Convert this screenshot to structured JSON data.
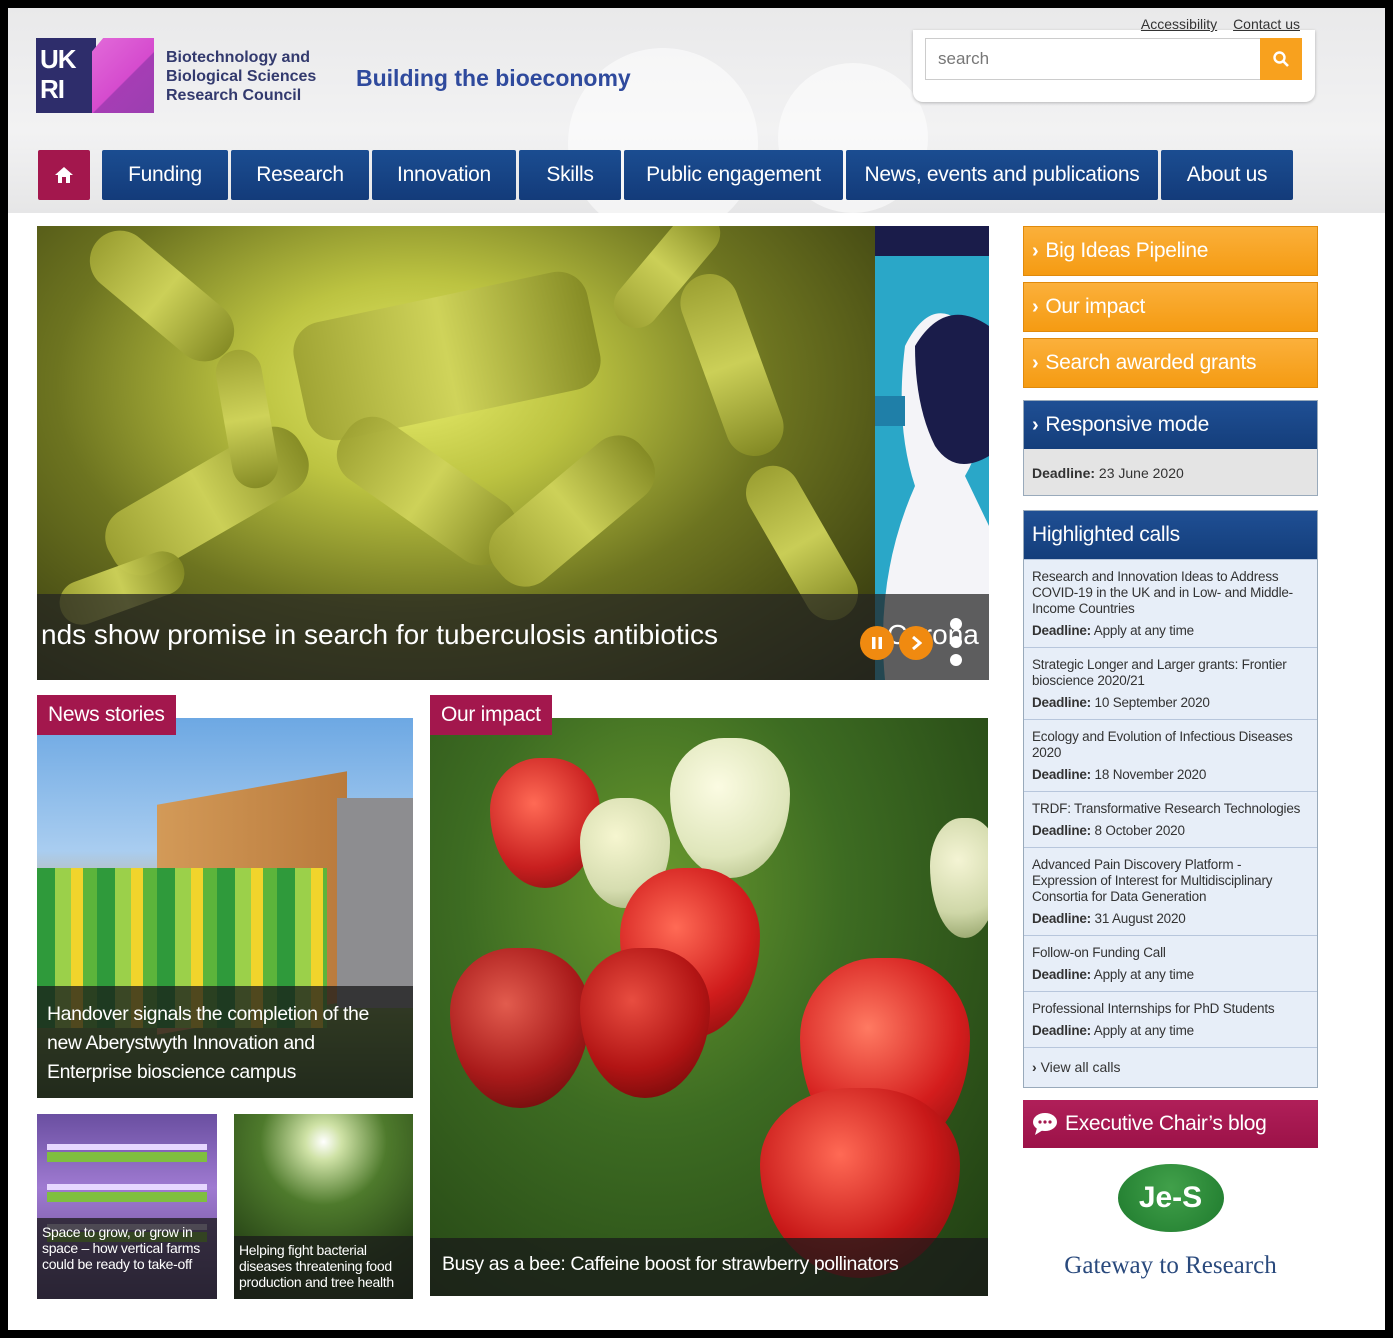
{
  "header": {
    "org_lines": [
      "Biotechnology and",
      "Biological Sciences",
      "Research Council"
    ],
    "logo_text": "UK RI",
    "tagline": "Building the bioeconomy",
    "utility_links": [
      "Accessibility",
      "Contact us"
    ],
    "search_placeholder": "search"
  },
  "nav": {
    "home_icon": "home-icon",
    "items": [
      "Funding",
      "Research",
      "Innovation",
      "Skills",
      "Public engagement",
      "News, events and publications",
      "About us"
    ]
  },
  "hero": {
    "caption": "nds show promise in search for tuberculosis antibiotics",
    "caption_next": "Corona",
    "pause_icon": "pause-icon",
    "next_icon": "chevron-right-icon"
  },
  "news": {
    "tag": "News stories",
    "main_caption": "Handover signals the completion of the new Aberystwyth Innovation and Enterprise bioscience campus",
    "small": [
      "Space to grow, or grow in space – how vertical farms could be ready to take-off",
      "Helping fight bacterial diseases threatening food production and tree health"
    ]
  },
  "impact": {
    "tag": "Our impact",
    "caption": "Busy as a bee: Caffeine boost for strawberry pollinators"
  },
  "sidebar": {
    "orange": [
      "Big Ideas Pipeline",
      "Our impact",
      "Search awarded grants"
    ],
    "responsive": {
      "title": "Responsive mode",
      "deadline_label": "Deadline:",
      "deadline": "23 June 2020"
    },
    "calls_title": "Highlighted calls",
    "calls": [
      {
        "title": "Research and Innovation Ideas to Address COVID-19 in the UK and in Low- and Middle-Income Countries",
        "deadline": "Apply at any time"
      },
      {
        "title": "Strategic Longer and Larger grants: Frontier bioscience 2020/21",
        "deadline": "10 September 2020"
      },
      {
        "title": "Ecology and Evolution of Infectious Diseases 2020",
        "deadline": "18 November 2020"
      },
      {
        "title": "TRDF: Transformative Research Technologies",
        "deadline": "8 October 2020"
      },
      {
        "title": "Advanced Pain Discovery Platform - Expression of Interest for Multidisciplinary Consortia for Data Generation",
        "deadline": "31 August 2020"
      },
      {
        "title": "Follow-on Funding Call",
        "deadline": "Apply at any time"
      },
      {
        "title": "Professional Internships for PhD Students",
        "deadline": "Apply at any time"
      }
    ],
    "deadline_label": "Deadline:",
    "view_all": "View all calls",
    "blog": "Executive Chair’s blog",
    "jes_logo": "Je-S",
    "gtr": "Gateway to Research"
  },
  "colors": {
    "nav_blue": "#1b4d91",
    "accent_orange": "#f8a11e",
    "accent_magenta": "#a3174d",
    "calls_bg": "#e7eef8"
  }
}
